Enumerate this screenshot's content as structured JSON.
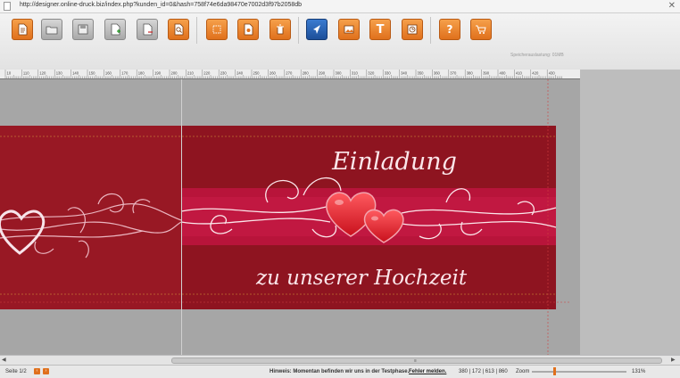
{
  "browser": {
    "url": "http://designer.online-druck.biz/index.php?kunden_id=0&hash=758f74e6da98470e7002d3f97b2058db"
  },
  "toolbar": {
    "buttons": [
      {
        "icon": "new-page-icon",
        "style": "orange"
      },
      {
        "icon": "open-folder-icon",
        "style": "gray"
      },
      {
        "icon": "save-icon",
        "style": "gray"
      },
      {
        "icon": "add-page-icon",
        "style": "gray"
      },
      {
        "icon": "remove-page-icon",
        "style": "gray"
      },
      {
        "icon": "preview-icon",
        "style": "orange"
      },
      {
        "icon": "crop-icon",
        "style": "orange"
      },
      {
        "icon": "page-settings-icon",
        "style": "orange"
      },
      {
        "icon": "delete-icon",
        "style": "orange"
      },
      {
        "icon": "pointer-icon",
        "style": "blue"
      },
      {
        "icon": "image-icon",
        "style": "orange"
      },
      {
        "icon": "text-icon",
        "style": "orange"
      },
      {
        "icon": "clipart-icon",
        "style": "orange"
      },
      {
        "icon": "help-icon",
        "style": "orange"
      },
      {
        "icon": "cart-icon",
        "style": "orange"
      }
    ],
    "text_button_label": "T",
    "help_button_label": "?",
    "memory_label": "Speicherauslastung: 01MB"
  },
  "ruler": {
    "labels": [
      "10",
      "110",
      "120",
      "130",
      "140",
      "150",
      "160",
      "170",
      "180",
      "190",
      "200",
      "210",
      "220",
      "230",
      "240",
      "250",
      "260",
      "270",
      "280",
      "290",
      "300",
      "310",
      "320",
      "330",
      "340",
      "350",
      "360",
      "370",
      "380",
      "390",
      "400",
      "410",
      "420",
      "430"
    ]
  },
  "card": {
    "title": "Einladung",
    "subtitle": "zu unserer Hochzeit",
    "colors": {
      "base": "#8e1420",
      "band": "#b8143a",
      "script": "#fbe6ea",
      "heart": "#e11d2a"
    }
  },
  "status": {
    "page_label": "Seite 1/2",
    "prev_label": "‹",
    "next_label": "›",
    "notice_label": "Hinweis: Momentan befinden wir uns in der Testphase.",
    "report_link": "Fehler melden.",
    "coords": "380 | 172 | 613 | 860",
    "zoom_label": "Zoom",
    "zoom_percent": "131%",
    "zoom_level": 0.24
  }
}
